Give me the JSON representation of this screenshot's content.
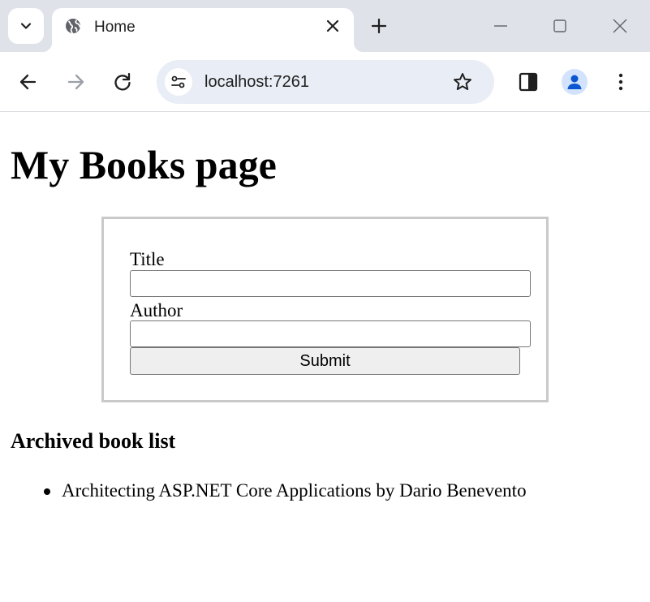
{
  "browser": {
    "tab": {
      "title": "Home"
    },
    "address_bar": {
      "url": "localhost:7261"
    },
    "icons": {
      "tab_search": "chevron-down-icon",
      "favicon": "globe-icon",
      "tab_close": "close-icon",
      "new_tab": "plus-icon",
      "minimize": "minimize-icon",
      "maximize": "maximize-icon",
      "close_window": "close-icon",
      "back": "arrow-left-icon",
      "forward": "arrow-right-icon",
      "reload": "reload-icon",
      "site_info": "tune-icon",
      "bookmark": "star-icon",
      "side_panel": "side-panel-icon",
      "profile": "person-icon",
      "menu": "kebab-menu-icon"
    },
    "colors": {
      "tabstrip": "#dfe3e9",
      "omnibox": "#e9edf5",
      "profile_bg": "#d3e3fd",
      "profile_fg": "#0b57d0"
    }
  },
  "page": {
    "title": "My Books page",
    "form": {
      "title_label": "Title",
      "title_value": "",
      "author_label": "Author",
      "author_value": "",
      "submit_label": "Submit"
    },
    "archived": {
      "heading": "Archived book list",
      "items": [
        {
          "text": "Architecting ASP.NET Core Applications by Dario Benevento"
        }
      ]
    }
  }
}
